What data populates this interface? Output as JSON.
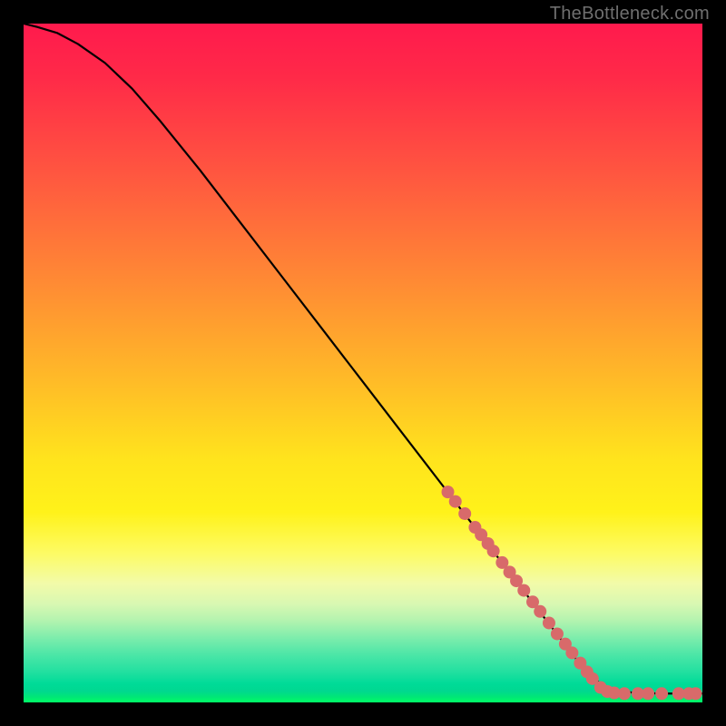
{
  "watermark": "TheBottleneck.com",
  "chart_data": {
    "type": "line",
    "title": "",
    "xlabel": "",
    "ylabel": "",
    "xlim": [
      0,
      100
    ],
    "ylim": [
      0,
      100
    ],
    "grid": false,
    "legend": false,
    "series": [
      {
        "name": "curve",
        "color": "#000000",
        "x": [
          0,
          2,
          5,
          8,
          12,
          16,
          20,
          26,
          32,
          38,
          44,
          50,
          56,
          62,
          68,
          74,
          78,
          81,
          83,
          86,
          90,
          94,
          98,
          100
        ],
        "y": [
          100,
          99.5,
          98.6,
          97.0,
          94.2,
          90.4,
          85.8,
          78.4,
          70.6,
          62.8,
          55.0,
          47.2,
          39.4,
          31.6,
          23.8,
          16.0,
          10.8,
          6.9,
          4.3,
          2.0,
          1.4,
          1.3,
          1.3,
          1.3
        ]
      },
      {
        "name": "dots",
        "color": "#d86a6a",
        "x": [
          62.5,
          63.6,
          65.0,
          66.5,
          67.4,
          68.4,
          69.2,
          70.5,
          71.6,
          72.6,
          73.7,
          75.0,
          76.1,
          77.4,
          78.6,
          79.8,
          80.8,
          82.0,
          83.0,
          83.8,
          85.0,
          86.0,
          87.0,
          88.5,
          90.5,
          92.0,
          94.0,
          96.5,
          98.0,
          99.0
        ],
        "y": [
          31.0,
          29.6,
          27.8,
          25.8,
          24.7,
          23.4,
          22.3,
          20.6,
          19.2,
          17.9,
          16.5,
          14.8,
          13.4,
          11.7,
          10.1,
          8.6,
          7.3,
          5.8,
          4.5,
          3.5,
          2.2,
          1.6,
          1.4,
          1.3,
          1.3,
          1.3,
          1.3,
          1.3,
          1.3,
          1.3
        ]
      }
    ],
    "background_gradient_stops": [
      {
        "pos": 0,
        "color": "#ff1a4d"
      },
      {
        "pos": 0.38,
        "color": "#ff8a34"
      },
      {
        "pos": 0.64,
        "color": "#ffe31d"
      },
      {
        "pos": 0.82,
        "color": "#f2fba9"
      },
      {
        "pos": 0.93,
        "color": "#4be6a7"
      },
      {
        "pos": 1.0,
        "color": "#00ff66"
      }
    ]
  }
}
